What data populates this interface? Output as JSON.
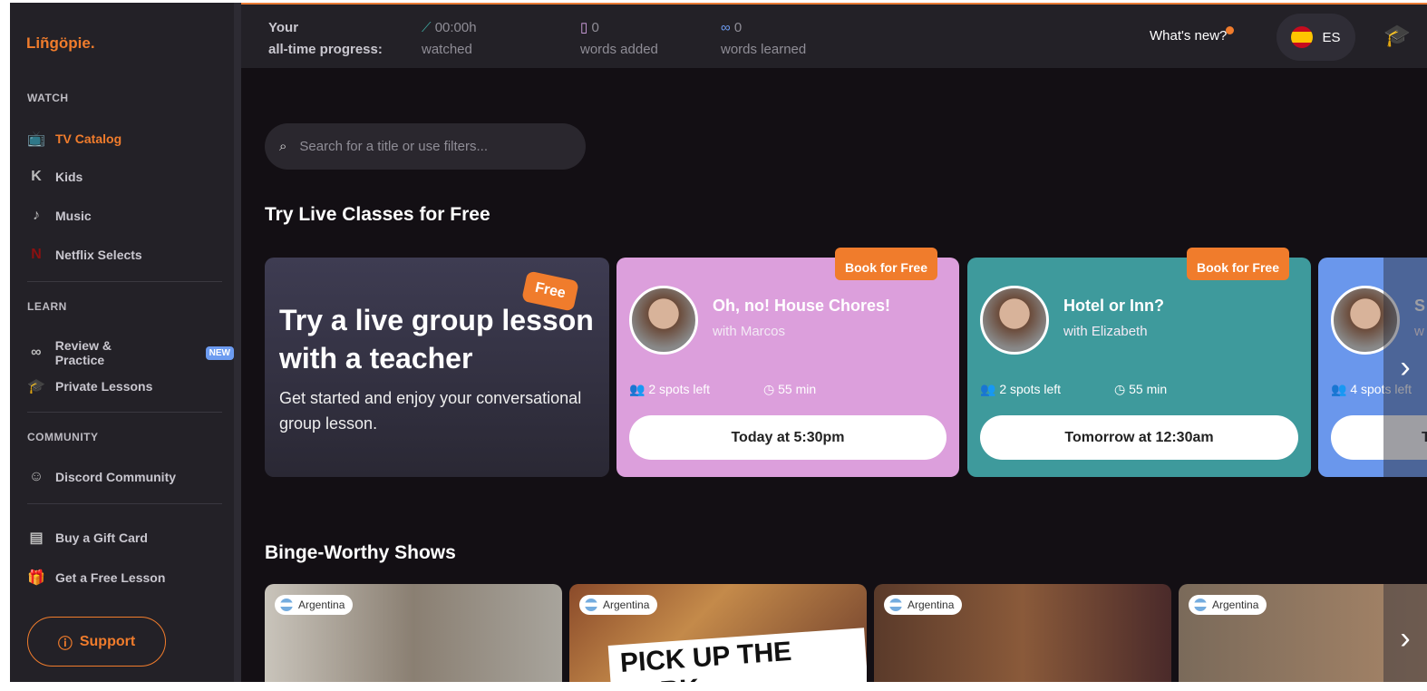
{
  "brand": {
    "logo": "Liñgöpie."
  },
  "sidebar": {
    "sections": [
      "WATCH",
      "LEARN",
      "COMMUNITY"
    ],
    "watch": [
      {
        "label": "TV Catalog",
        "icon": "tv-icon",
        "active": true
      },
      {
        "label": "Kids",
        "icon": "kids-icon"
      },
      {
        "label": "Music",
        "icon": "guitar-icon"
      },
      {
        "label": "Netflix Selects",
        "icon": "netflix-icon"
      }
    ],
    "learn": [
      {
        "label": "Review & Practice",
        "icon": "glasses-icon",
        "badge": "NEW"
      },
      {
        "label": "Private Lessons",
        "icon": "graduation-cap-icon"
      }
    ],
    "community": [
      {
        "label": "Discord Community",
        "icon": "discord-icon"
      }
    ],
    "extra": [
      {
        "label": "Buy a Gift Card",
        "icon": "gift-card-icon"
      },
      {
        "label": "Get a Free Lesson",
        "icon": "gift-icon"
      }
    ],
    "support": "Support"
  },
  "topbar": {
    "progress_label_1": "Your",
    "progress_label_2": "all-time progress:",
    "watched_value": "00:00h",
    "watched_label": "watched",
    "words_added_value": "0",
    "words_added_label": "words added",
    "words_learned_value": "0",
    "words_learned_label": "words learned",
    "whats_new": "What's new?",
    "language": "ES"
  },
  "search": {
    "placeholder": "Search for a title or use filters..."
  },
  "live": {
    "heading": "Try Live Classes for Free",
    "promo": {
      "title": "Try a live group lesson with a teacher",
      "subtitle": "Get started and enjoy your conversational group lesson.",
      "badge": "Free"
    },
    "classes": [
      {
        "badge": "Book for Free",
        "title": "Oh, no! House Chores!",
        "teacher": "with Marcos",
        "spots": "2 spots left",
        "duration": "55 min",
        "time": "Today at 5:30pm",
        "color": "#dc9fdc"
      },
      {
        "badge": "Book for Free",
        "title": "Hotel or Inn?",
        "teacher": "with Elizabeth",
        "spots": "2 spots left",
        "duration": "55 min",
        "time": "Tomorrow at 12:30am",
        "color": "#3e9a9c"
      },
      {
        "title": "S",
        "teacher": "w",
        "spots": "4 spots left",
        "time": "T",
        "color": "#6a97ec"
      }
    ]
  },
  "binge": {
    "heading": "Binge-Worthy Shows",
    "shows": [
      {
        "tag": "Argentina"
      },
      {
        "tag": "Argentina",
        "art": "PICK UP THE FORK"
      },
      {
        "tag": "Argentina"
      },
      {
        "tag": "Argentina"
      }
    ]
  }
}
